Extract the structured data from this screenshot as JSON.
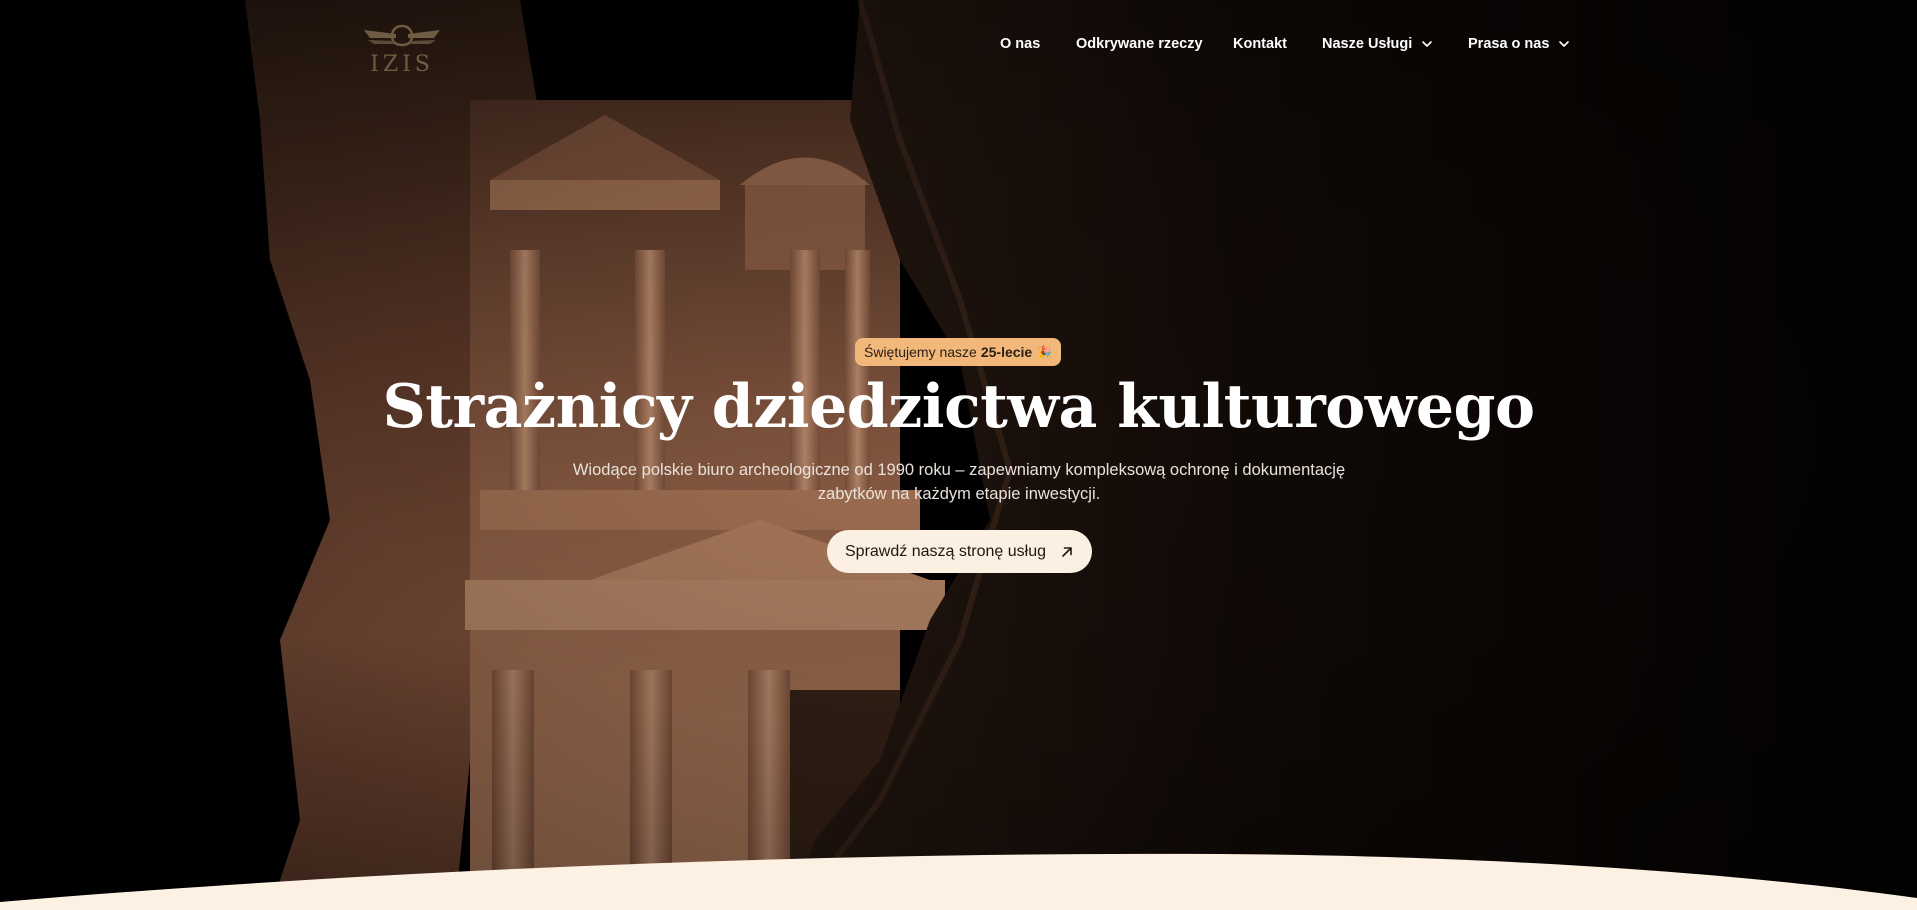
{
  "nav": {
    "logo_text": "IZIS",
    "items": [
      {
        "label": "O nas"
      },
      {
        "label": "Odkrywane rzeczy"
      },
      {
        "label": "Kontakt"
      },
      {
        "label": "Nasze Usługi"
      },
      {
        "label": "Prasa o nas"
      }
    ]
  },
  "hero": {
    "badge_prefix": "Świętujemy nasze",
    "badge_bold": "25-lecie",
    "badge_emoji": "🎉",
    "headline": "Strażnicy dziedzictwa kulturowego",
    "subtitle": "Wiodące polskie biuro archeologiczne od 1990 roku – zapewniamy kompleksową ochronę i dokumentację zabytków na każdym etapie inwestycji.",
    "cta_label": "Sprawdź naszą stronę usług"
  },
  "icons": {
    "logo": "winged-emblem-icon",
    "dropdown": "chevron-down-icon",
    "cta_arrow": "arrow-up-right-icon"
  },
  "colors": {
    "background": "#000000",
    "badge_bg": "#f2b87a",
    "cta_bg": "#fbf0e1",
    "wave": "#fdf1e3",
    "stone": "#a0684a"
  }
}
